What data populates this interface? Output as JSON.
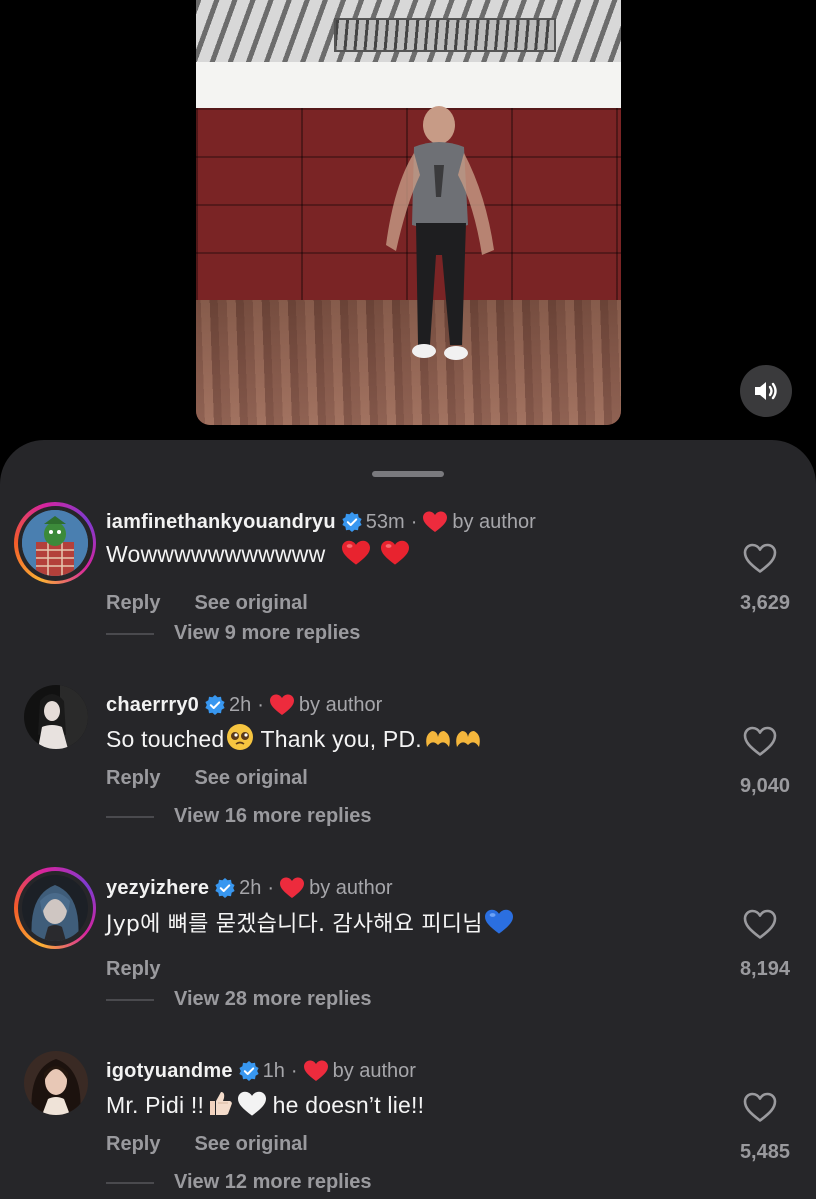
{
  "video": {
    "sound_icon": "speaker-icon"
  },
  "comments": [
    {
      "username": "iamfinethankyouandryu",
      "time": "53m",
      "separator": "·",
      "liked_by_author": "by author",
      "text": "Wowwwwwwwwwww",
      "reply": "Reply",
      "see_original": "See original",
      "likes": "3,629",
      "view_replies": "View 9 more replies"
    },
    {
      "username": "chaerrry0",
      "time": "2h",
      "separator": "·",
      "liked_by_author": "by author",
      "text_a": "So touched",
      "text_b": " Thank you, PD.",
      "reply": "Reply",
      "see_original": "See original",
      "likes": "9,040",
      "view_replies": "View 16 more replies"
    },
    {
      "username": "yezyizhere",
      "time": "2h",
      "separator": "·",
      "liked_by_author": "by author",
      "text": "Jyp에 뼈를 묻겠습니다. 감사해요 피디님",
      "reply": "Reply",
      "likes": "8,194",
      "view_replies": "View 28 more replies"
    },
    {
      "username": "igotyuandme",
      "time": "1h",
      "separator": "·",
      "liked_by_author": "by author",
      "text_a": "Mr. Pidi !!",
      "text_b": " he doesn’t lie!!",
      "reply": "Reply",
      "see_original": "See original",
      "likes": "5,485",
      "view_replies": "View 12 more replies"
    }
  ],
  "colors": {
    "sheet_bg": "#262629",
    "verified": "#3897f0",
    "heart_red": "#ed2b3d",
    "muted": "#9a9a9e"
  }
}
